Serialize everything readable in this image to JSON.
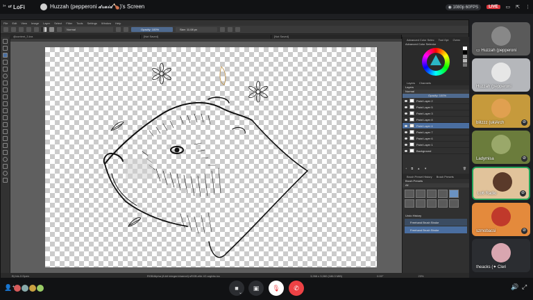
{
  "top": {
    "server_tag": "ᵒᶠ LoFi",
    "server_num": "³⁴",
    "stream_title": "Huzzah (pepperoni 𝓭𝓻𝓾𝓲𝓭🍗)'s Screen",
    "quality": "1080p 60FPS",
    "live": "LIVE"
  },
  "krita": {
    "menu": [
      "File",
      "Edit",
      "View",
      "Image",
      "Layer",
      "Select",
      "Filter",
      "Tools",
      "Settings",
      "Window",
      "Help"
    ],
    "blend_mode": "Normal",
    "opacity": "Opacity: 100%",
    "size": "Size: 11.08 px",
    "tabs": [
      "@content_3.kra",
      "[Not Saved]",
      "[Not Saved]"
    ],
    "status_left": "B) Ink-3 Gpen",
    "status_mid": "RGB/Alpha (8-bit integer/channel)  sRGB-elle-V2-srgbtrc.icc",
    "status_right": "3,266 x 3,060 (186.3 MiB)",
    "zoom": "23%",
    "angle": "0.00°"
  },
  "dock": {
    "top_tabs": [
      "Advanced Color Selec",
      "Tool Opt",
      "Overv"
    ],
    "selector_title": "Advanced Color Selector",
    "layers_tabs": [
      "Layers",
      "Channels"
    ],
    "layers_title": "Layers",
    "blend": "Normal",
    "opacity": "Opacity: 100%",
    "layers": [
      {
        "name": "Paint Layer 2",
        "selected": false
      },
      {
        "name": "Paint Layer 5",
        "selected": false
      },
      {
        "name": "Paint Layer 3",
        "selected": false
      },
      {
        "name": "Paint Layer 8",
        "selected": false
      },
      {
        "name": "Paint Layer 4",
        "selected": true
      },
      {
        "name": "Paint Layer 7",
        "selected": false
      },
      {
        "name": "Paint Layer 6",
        "selected": false
      },
      {
        "name": "Paint Layer 1",
        "selected": false
      },
      {
        "name": "Background",
        "selected": false
      }
    ],
    "brush_tabs": [
      "Brush Preset History",
      "Brush Presets"
    ],
    "brush_title": "Brush Presets",
    "brush_filter": "All",
    "undo_title": "Undo History",
    "undo_items": [
      "Freehand Brush Stroke",
      "Freehand Brush Stroke"
    ]
  },
  "participants": [
    {
      "name": "Huzzah (pepperoni",
      "color": "#5a5a5a",
      "muted": false
    },
    {
      "name": "Huzzah (pepperoni",
      "color": "#b5b7bb",
      "muted": false
    },
    {
      "name": "blitzzz (ukiArch",
      "color": "#c69a3c",
      "muted": true
    },
    {
      "name": "Ladymisa",
      "color": "#6b7c3c",
      "muted": true
    },
    {
      "name": "Lo6 Radio",
      "color": "#e1c39b",
      "muted": true
    },
    {
      "name": "szmobacsi",
      "color": "#e48a3c",
      "muted": true
    },
    {
      "name": "theacks (✦ Cleri",
      "color": "#1e1f22",
      "muted": false
    }
  ],
  "colors": {
    "accent": "#4a6ea0",
    "live": "#da373c",
    "danger": "#ed4245"
  }
}
